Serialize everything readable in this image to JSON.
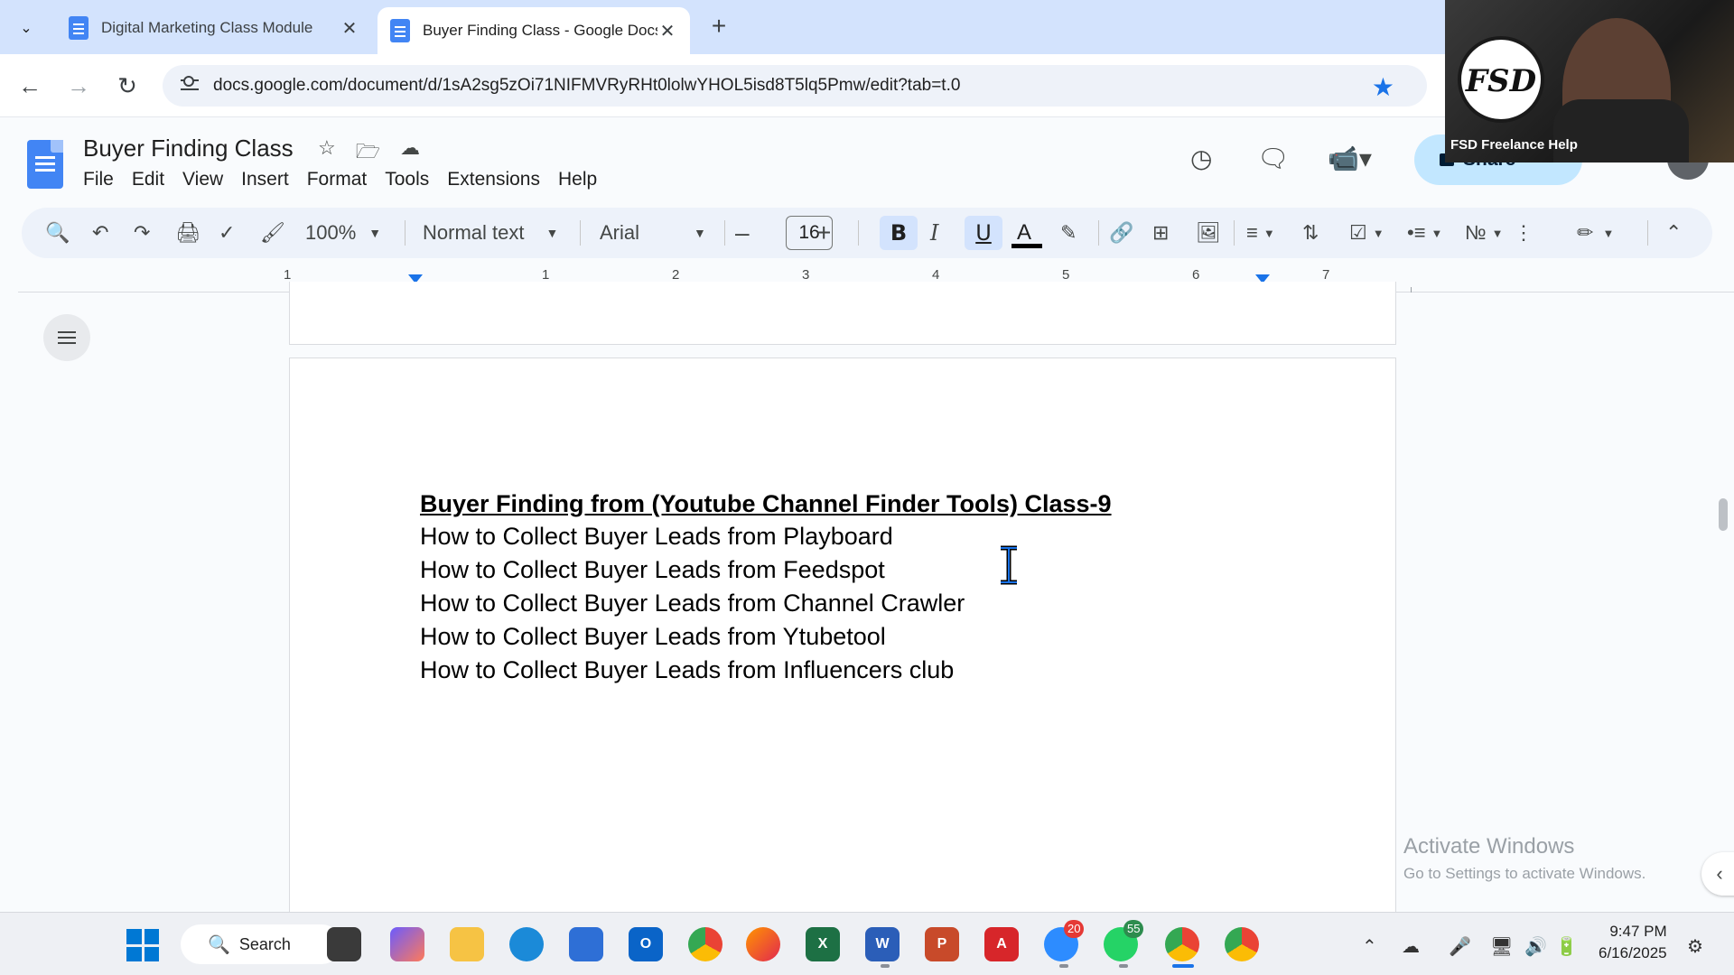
{
  "browser": {
    "tabs": [
      {
        "title": "Digital Marketing Class Module",
        "active": false
      },
      {
        "title": "Buyer Finding Class - Google Docs",
        "active": true
      }
    ],
    "new_tab": "+",
    "url": "docs.google.com/document/d/1sA2sg5zOi71NIFMVRyRHt0lolwYHOL5isd8T5lq5Pmw/edit?tab=t.0"
  },
  "docs": {
    "title": "Buyer Finding Class",
    "menu": [
      "File",
      "Edit",
      "View",
      "Insert",
      "Format",
      "Tools",
      "Extensions",
      "Help"
    ],
    "share_label": "Share"
  },
  "toolbar": {
    "zoom": "100%",
    "style": "Normal text",
    "font": "Arial",
    "font_size": "16",
    "bold": "B",
    "italic": "I",
    "underline": "U",
    "text_color_letter": "A"
  },
  "ruler": {
    "numbers": [
      "1",
      "1",
      "2",
      "3",
      "4",
      "5",
      "6",
      "7"
    ]
  },
  "document": {
    "heading": "Buyer Finding from (Youtube Channel Finder Tools) Class-9",
    "lines": [
      "How to Collect Buyer Leads from Playboard",
      "How to Collect Buyer Leads from Feedspot",
      "How to Collect Buyer Leads from Channel Crawler",
      "How to Collect Buyer Leads from Ytubetool",
      "How to Collect Buyer Leads from Influencers club"
    ]
  },
  "watermark": {
    "line1": "Activate Windows",
    "line2": "Go to Settings to activate Windows."
  },
  "webcam": {
    "logo": "FSD",
    "label": "FSD Freelance Help"
  },
  "taskbar": {
    "search_label": "Search",
    "zoom_badge": "20",
    "whatsapp_badge": "55",
    "time": "9:47 PM",
    "date": "6/16/2025"
  },
  "colors": {
    "accent": "#1a73e8",
    "tabstrip": "#d3e3fd",
    "toolbar": "#edf2fa",
    "share": "#c2e7ff"
  }
}
